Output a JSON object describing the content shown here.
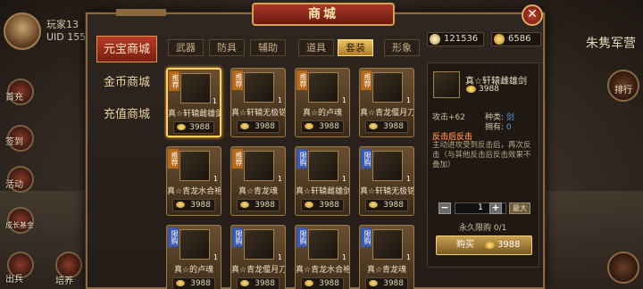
{
  "hud": {
    "player_name": "玩家13",
    "uid_label": "UID",
    "uid_value": "155",
    "side_buttons": [
      "首充",
      "签到",
      "活动",
      "成长基金",
      "出兵",
      "培养"
    ],
    "right_title": "朱隽军营",
    "right_button": "排行"
  },
  "dialog": {
    "title": "商城",
    "close": "✕"
  },
  "categories": [
    {
      "label": "元宝商城",
      "active": true
    },
    {
      "label": "金币商城",
      "active": false
    },
    {
      "label": "充值商城",
      "active": false
    }
  ],
  "tabs": [
    {
      "label": "武器",
      "active": false
    },
    {
      "label": "防具",
      "active": false
    },
    {
      "label": "辅助",
      "active": false
    },
    {
      "label": "道具",
      "active": false
    },
    {
      "label": "套装",
      "active": true
    },
    {
      "label": "形象",
      "active": false
    }
  ],
  "currency": {
    "silver": "121536",
    "gold": "6586",
    "silver_icon": "silver-coin-icon",
    "gold_icon": "gold-ingot-icon"
  },
  "items": [
    {
      "name": "真☆轩辕雌雄剑",
      "price": "3988",
      "qty": "1",
      "tag": "推荐",
      "tag_color": "orange",
      "selected": true
    },
    {
      "name": "真☆轩辕无极铠",
      "price": "3988",
      "qty": "1",
      "tag": "推荐",
      "tag_color": "orange"
    },
    {
      "name": "真☆的卢魂",
      "price": "3988",
      "qty": "1",
      "tag": "推荐",
      "tag_color": "orange"
    },
    {
      "name": "真☆青龙偃月刀",
      "price": "3988",
      "qty": "1",
      "tag": "推荐",
      "tag_color": "orange"
    },
    {
      "name": "真☆青龙水合袍",
      "price": "3988",
      "qty": "1",
      "tag": "推荐",
      "tag_color": "orange"
    },
    {
      "name": "真☆青龙魂",
      "price": "3988",
      "qty": "1",
      "tag": "推荐",
      "tag_color": "orange"
    },
    {
      "name": "真☆轩辕雌雄剑",
      "price": "3988",
      "qty": "1",
      "tag": "限购",
      "tag_color": "blue"
    },
    {
      "name": "真☆轩辕无极铠",
      "price": "3988",
      "qty": "1",
      "tag": "限购",
      "tag_color": "blue"
    },
    {
      "name": "真☆的卢魂",
      "price": "3988",
      "qty": "1",
      "tag": "限购",
      "tag_color": "blue"
    },
    {
      "name": "真☆青龙偃月刀",
      "price": "3988",
      "qty": "1",
      "tag": "限购",
      "tag_color": "blue"
    },
    {
      "name": "真☆青龙水合袍",
      "price": "3988",
      "qty": "1",
      "tag": "限购",
      "tag_color": "blue"
    },
    {
      "name": "真☆青龙魂",
      "price": "3988",
      "qty": "1",
      "tag": "限购",
      "tag_color": "blue"
    }
  ],
  "detail": {
    "name": "真☆轩辕雌雄剑",
    "price": "3988",
    "attack": "攻击+62",
    "kind_label": "种类:",
    "kind_value": "剑",
    "own_label": "拥有:",
    "own_value": "0",
    "skill_title": "反击后反击",
    "skill_desc": "主动进攻受到反击后，再次反击（与其他反击后反击效果不叠加）",
    "minus": "−",
    "plus": "+",
    "quantity": "1",
    "max_label": "最大",
    "limit": "永久限购 0/1",
    "buy_label": "购买",
    "buy_price": "3988"
  }
}
